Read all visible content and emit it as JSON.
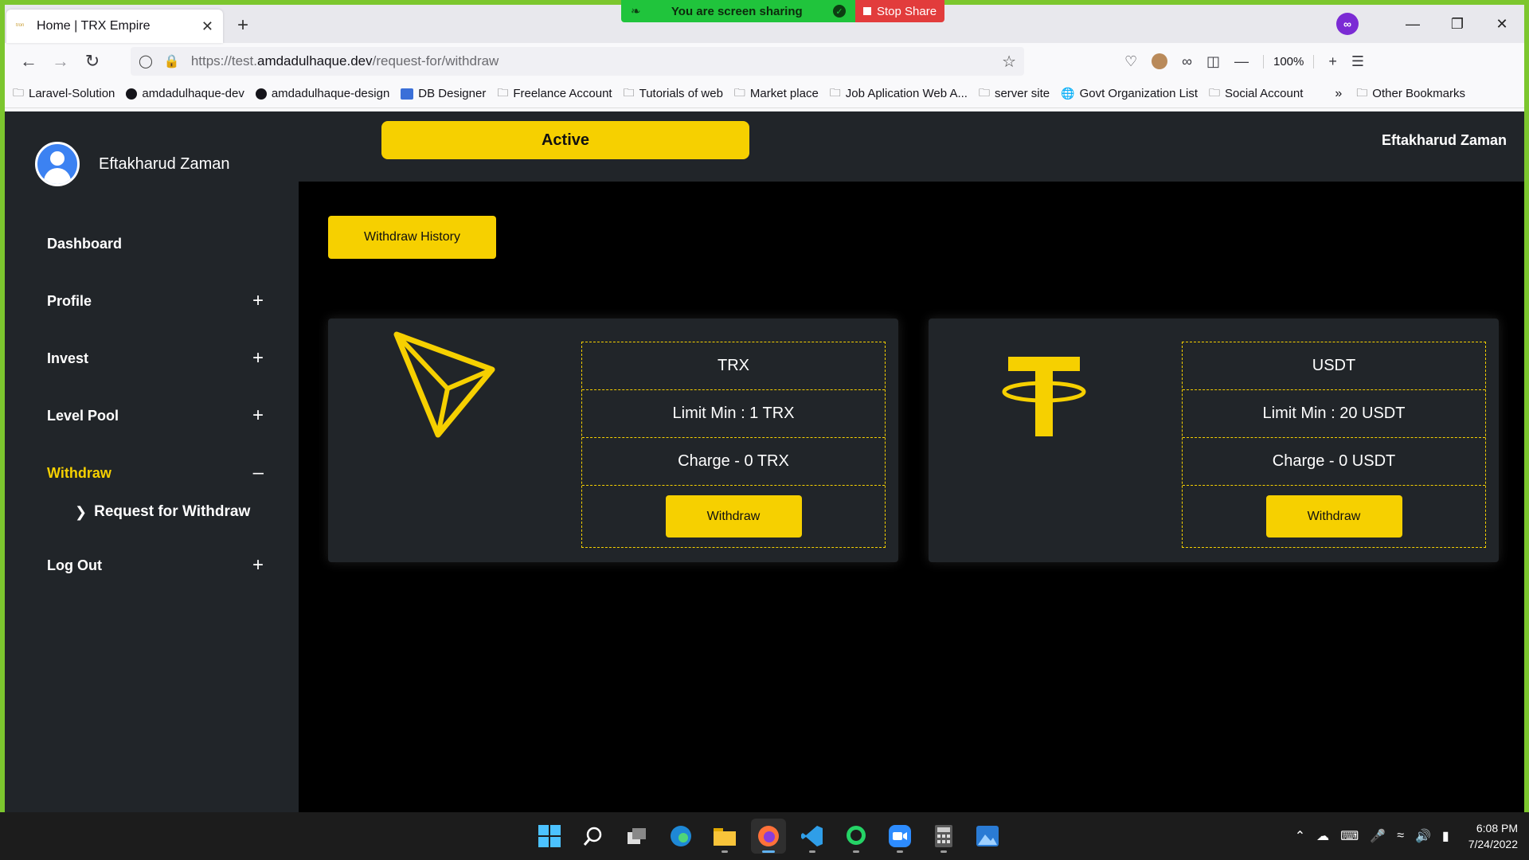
{
  "screen_share": {
    "message": "You are screen sharing",
    "stop_label": "Stop Share"
  },
  "browser": {
    "tab": {
      "title": "Home | TRX Empire",
      "favicon_text": "tron"
    },
    "url": {
      "prefix": "https://test.",
      "domain": "amdadulhaque.dev",
      "path": "/request-for/withdraw"
    },
    "zoom": "100%",
    "bookmarks": [
      {
        "label": "Laravel-Solution",
        "icon": "folder-icon"
      },
      {
        "label": "amdadulhaque-dev",
        "icon": "github-icon"
      },
      {
        "label": "amdadulhaque-design",
        "icon": "github-icon"
      },
      {
        "label": "DB Designer",
        "icon": "db-icon"
      },
      {
        "label": "Freelance Account",
        "icon": "folder-icon"
      },
      {
        "label": "Tutorials of web",
        "icon": "folder-icon"
      },
      {
        "label": "Market place",
        "icon": "folder-icon"
      },
      {
        "label": "Job Aplication Web A...",
        "icon": "folder-icon"
      },
      {
        "label": "server site",
        "icon": "folder-icon"
      },
      {
        "label": "Govt Organization List",
        "icon": "globe-icon"
      },
      {
        "label": "Social Account",
        "icon": "folder-icon"
      }
    ],
    "other_bookmarks": "Other Bookmarks"
  },
  "sidebar": {
    "user_name": "Eftakharud Zaman",
    "menu": {
      "dashboard": "Dashboard",
      "profile": "Profile",
      "invest": "Invest",
      "level_pool": "Level Pool",
      "withdraw": "Withdraw",
      "request_withdraw": "Request for Withdraw",
      "logout": "Log Out"
    }
  },
  "topbar": {
    "status_label": "Active",
    "user_name": "Eftakharud Zaman"
  },
  "main": {
    "history_button": "Withdraw History",
    "cards": [
      {
        "currency": "TRX",
        "limit": "Limit Min : 1 TRX",
        "charge": "Charge - 0 TRX",
        "button": "Withdraw"
      },
      {
        "currency": "USDT",
        "limit": "Limit Min : 20 USDT",
        "charge": "Charge - 0 USDT",
        "button": "Withdraw"
      }
    ]
  },
  "taskbar": {
    "time": "6:08 PM",
    "date": "7/24/2022"
  },
  "colors": {
    "accent": "#f6d000",
    "panel": "#212529",
    "background": "#000000"
  }
}
